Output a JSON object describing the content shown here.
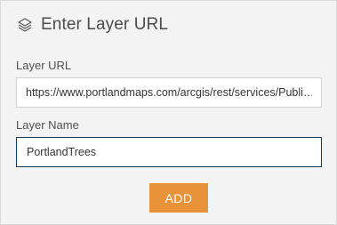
{
  "header": {
    "title": "Enter Layer URL",
    "icon": "layers-icon"
  },
  "form": {
    "url_label": "Layer URL",
    "url_value": "https://www.portlandmaps.com/arcgis/rest/services/Publi…",
    "name_label": "Layer Name",
    "name_value": "PortlandTrees",
    "add_label": "ADD"
  },
  "colors": {
    "accent": "#e8923a",
    "focus_border": "#1a3a5a"
  }
}
